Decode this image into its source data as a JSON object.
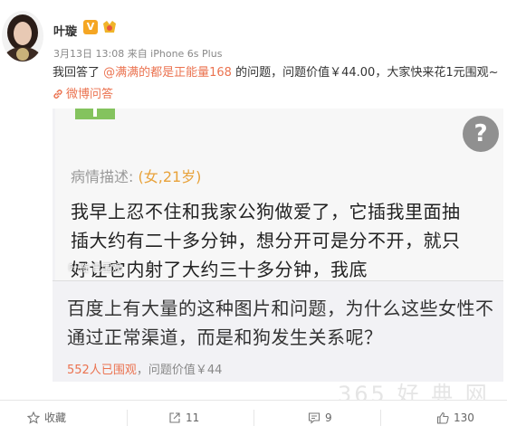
{
  "user": {
    "name": "叶璇",
    "verified_badge": "V",
    "meta": "3月13日 13:08 来自 iPhone 6s Plus"
  },
  "post": {
    "text_prefix": "我回答了 ",
    "mention": "@满满的都是正能量168",
    "text_suffix": " 的问题，问题价值￥44.00，大家快来花1元围观~",
    "link_label": "微博问答"
  },
  "card": {
    "desc_label": "病情描述: ",
    "desc_age": "(女,21岁)",
    "desc_body": "我早上忍不住和我家公狗做爱了，它插我里面抽插大约有二十多分钟，想分开可是分不开，就只好让它内射了大约三十多分钟，我底",
    "image_watermark": "叶璇 已围观",
    "help_icon": "?",
    "question": "百度上有大量的这种图片和问题，为什么这些女性不通过正常渠道，而是和狗发生关系呢？",
    "viewers": "552人已围观",
    "value": "，问题价值￥44"
  },
  "actions": {
    "favorite": "收藏",
    "repost": "11",
    "comment": "9",
    "like": "130"
  },
  "watermark": "365 好 典 网",
  "colors": {
    "accent": "#eb7350",
    "age": "#e8a23a",
    "green_tab": "#84c35e",
    "vbadge": "#f5a623"
  }
}
